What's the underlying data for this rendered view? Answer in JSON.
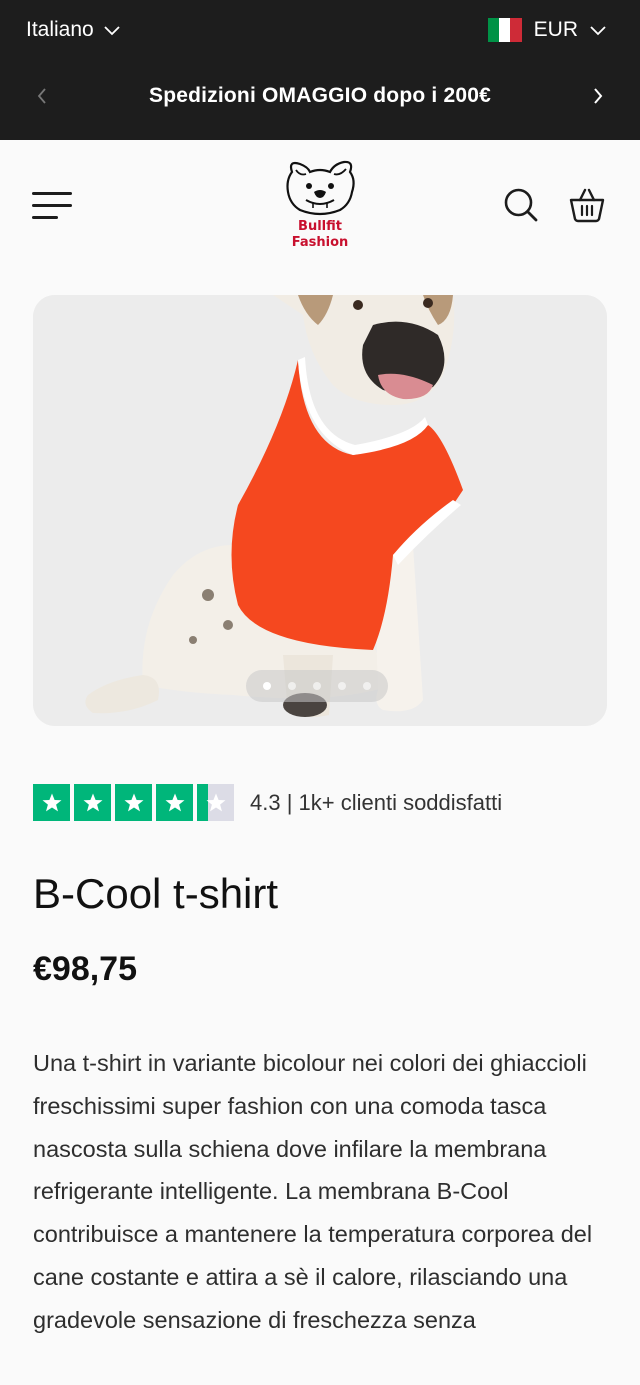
{
  "topbar": {
    "language": "Italiano",
    "currency": "EUR",
    "announcement": "Spedizioni OMAGGIO dopo i 200€",
    "flag_colors": [
      "#009246",
      "#ffffff",
      "#ce2b37"
    ]
  },
  "header": {
    "logo_line1": "Bullfit",
    "logo_line2": "Fashion",
    "brand_color": "#c8102e"
  },
  "gallery": {
    "slide_count": 5,
    "active_slide": 1,
    "tank_color": "#f5481f"
  },
  "rating": {
    "score": 4.3,
    "max": 5,
    "text": "4.3 | 1k+ clienti soddisfatti",
    "star_color": "#00b67a"
  },
  "product": {
    "title": "B-Cool t-shirt",
    "price": "€98,75",
    "description": "Una t-shirt in variante bicolour nei colori dei ghiaccioli freschissimi super fashion con una comoda tasca nascosta sulla schiena dove infilare la membrana refrigerante intelligente. La membrana B-Cool contribuisce a mantenere la temperatura corporea del cane costante e attira a sè il calore, rilasciando una gradevole sensazione di freschezza senza"
  }
}
